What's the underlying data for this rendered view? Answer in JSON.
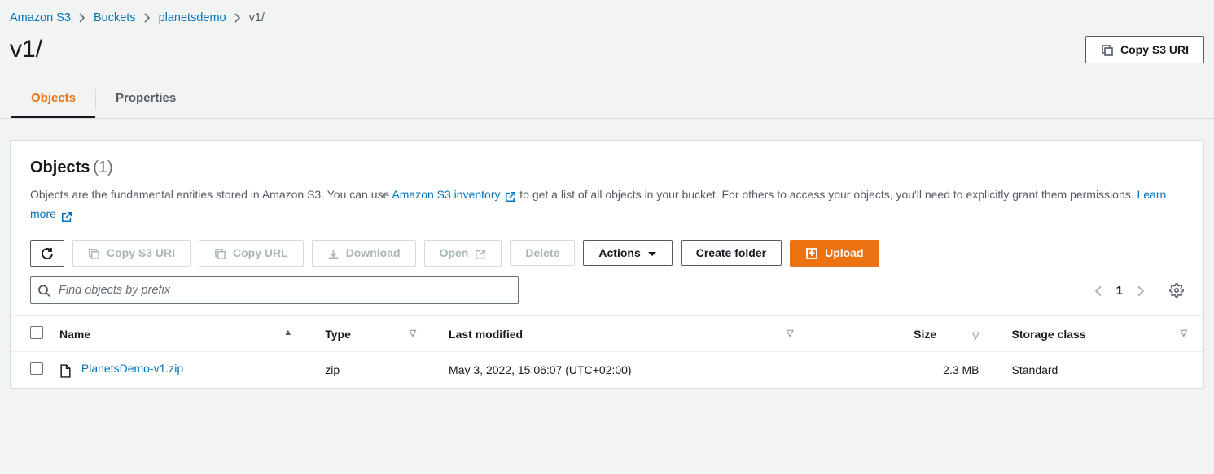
{
  "breadcrumb": {
    "items": [
      "Amazon S3",
      "Buckets",
      "planetsdemo"
    ],
    "current": "v1/"
  },
  "page": {
    "title": "v1/",
    "copy_uri_btn": "Copy S3 URI"
  },
  "tabs": {
    "objects": "Objects",
    "properties": "Properties"
  },
  "panel": {
    "title": "Objects",
    "count": "(1)",
    "desc_prefix": "Objects are the fundamental entities stored in Amazon S3. You can use ",
    "inventory_link": "Amazon S3 inventory",
    "desc_mid": " to get a list of all objects in your bucket. For others to access your objects, you'll need to explicitly grant them permissions. ",
    "learn_more": "Learn more"
  },
  "toolbar": {
    "copy_uri": "Copy S3 URI",
    "copy_url": "Copy URL",
    "download": "Download",
    "open": "Open",
    "delete": "Delete",
    "actions": "Actions",
    "create_folder": "Create folder",
    "upload": "Upload"
  },
  "search": {
    "placeholder": "Find objects by prefix"
  },
  "pager": {
    "current": "1"
  },
  "table": {
    "headers": {
      "name": "Name",
      "type": "Type",
      "last_modified": "Last modified",
      "size": "Size",
      "storage_class": "Storage class"
    },
    "rows": [
      {
        "name": "PlanetsDemo-v1.zip",
        "type": "zip",
        "last_modified": "May 3, 2022, 15:06:07 (UTC+02:00)",
        "size": "2.3 MB",
        "storage_class": "Standard"
      }
    ]
  }
}
